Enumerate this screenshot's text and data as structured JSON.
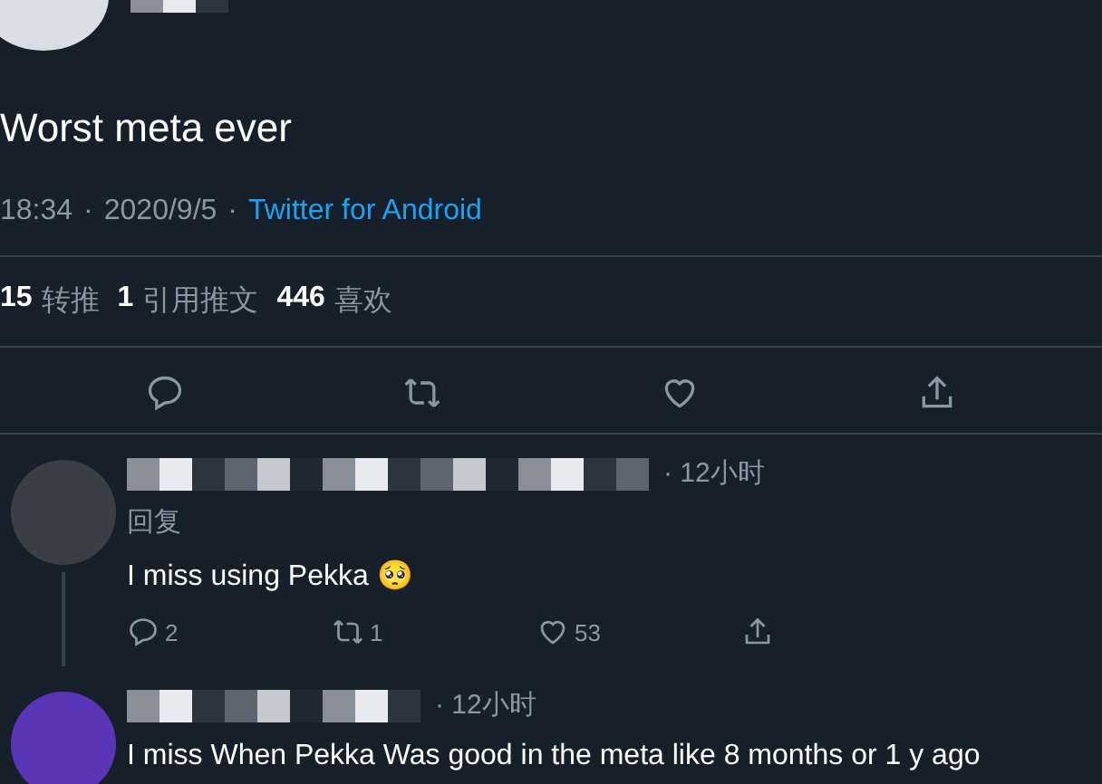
{
  "tweet": {
    "text": "Worst meta ever",
    "time": "18:34",
    "date": "2020/9/5",
    "source": "Twitter for Android",
    "separators": [
      "·",
      "·"
    ],
    "stats": [
      {
        "count": "15",
        "label": "转推"
      },
      {
        "count": "1",
        "label": "引用推文"
      },
      {
        "count": "446",
        "label": "喜欢"
      }
    ],
    "actions": [
      {
        "kind": "reply"
      },
      {
        "kind": "retweet"
      },
      {
        "kind": "like"
      },
      {
        "kind": "share"
      }
    ]
  },
  "replies": [
    {
      "time": "· 12小时",
      "replying_to": "回复",
      "text": "I miss using Pekka 🥺",
      "actions": [
        {
          "kind": "reply",
          "count": "2"
        },
        {
          "kind": "retweet",
          "count": "1"
        },
        {
          "kind": "like",
          "count": "53"
        },
        {
          "kind": "share"
        }
      ]
    },
    {
      "time": "· 12小时",
      "text": "I miss When Pekka Was good  in the meta like 8 months or 1 y ago"
    }
  ]
}
